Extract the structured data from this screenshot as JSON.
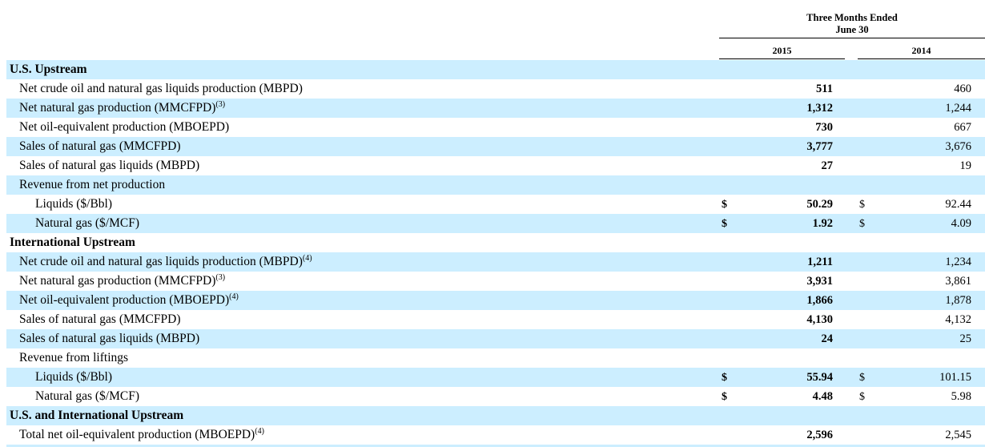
{
  "header": {
    "period_line1": "Three Months Ended",
    "period_line2": "June 30",
    "year1": "2015",
    "year2": "2014"
  },
  "rows": [
    {
      "label": "U.S. Upstream",
      "level": 0,
      "shade": true
    },
    {
      "label": "Net crude oil and natural gas liquids production (MBPD)",
      "level": 1,
      "shade": false,
      "v2015": "511",
      "v2014": "460"
    },
    {
      "label": "Net natural gas production (MMCFPD)",
      "sup": "(3)",
      "level": 1,
      "shade": true,
      "v2015": "1,312",
      "v2014": "1,244"
    },
    {
      "label": "Net oil-equivalent production (MBOEPD)",
      "level": 1,
      "shade": false,
      "v2015": "730",
      "v2014": "667"
    },
    {
      "label": "Sales of natural gas (MMCFPD)",
      "level": 1,
      "shade": true,
      "v2015": "3,777",
      "v2014": "3,676"
    },
    {
      "label": "Sales of natural gas liquids (MBPD)",
      "level": 1,
      "shade": false,
      "v2015": "27",
      "v2014": "19"
    },
    {
      "label": "Revenue from net production",
      "level": 1,
      "shade": true
    },
    {
      "label": "Liquids ($/Bbl)",
      "level": 2,
      "shade": false,
      "cur2015": "$",
      "v2015": "50.29",
      "cur2014": "$",
      "v2014": "92.44"
    },
    {
      "label": "Natural gas ($/MCF)",
      "level": 2,
      "shade": true,
      "cur2015": "$",
      "v2015": "1.92",
      "cur2014": "$",
      "v2014": "4.09"
    },
    {
      "label": "International Upstream",
      "level": 0,
      "shade": false
    },
    {
      "label": "Net crude oil and natural gas liquids production (MBPD)",
      "sup": "(4)",
      "level": 1,
      "shade": true,
      "v2015": "1,211",
      "v2014": "1,234"
    },
    {
      "label": "Net natural gas production (MMCFPD)",
      "sup": "(3)",
      "level": 1,
      "shade": false,
      "v2015": "3,931",
      "v2014": "3,861"
    },
    {
      "label": "Net oil-equivalent production (MBOEPD)",
      "sup": "(4)",
      "level": 1,
      "shade": true,
      "v2015": "1,866",
      "v2014": "1,878"
    },
    {
      "label": "Sales of natural gas (MMCFPD)",
      "level": 1,
      "shade": false,
      "v2015": "4,130",
      "v2014": "4,132"
    },
    {
      "label": "Sales of natural gas liquids (MBPD)",
      "level": 1,
      "shade": true,
      "v2015": "24",
      "v2014": "25"
    },
    {
      "label": "Revenue from liftings",
      "level": 1,
      "shade": false
    },
    {
      "label": "Liquids ($/Bbl)",
      "level": 2,
      "shade": true,
      "cur2015": "$",
      "v2015": "55.94",
      "cur2014": "$",
      "v2014": "101.15"
    },
    {
      "label": "Natural gas ($/MCF)",
      "level": 2,
      "shade": false,
      "cur2015": "$",
      "v2015": "4.48",
      "cur2014": "$",
      "v2014": "5.98"
    },
    {
      "label": "U.S. and International Upstream",
      "level": 0,
      "shade": true
    },
    {
      "label": "Total net oil-equivalent production (MBOEPD)",
      "sup": "(4)",
      "level": 1,
      "shade": false,
      "v2015": "2,596",
      "v2014": "2,545"
    }
  ]
}
